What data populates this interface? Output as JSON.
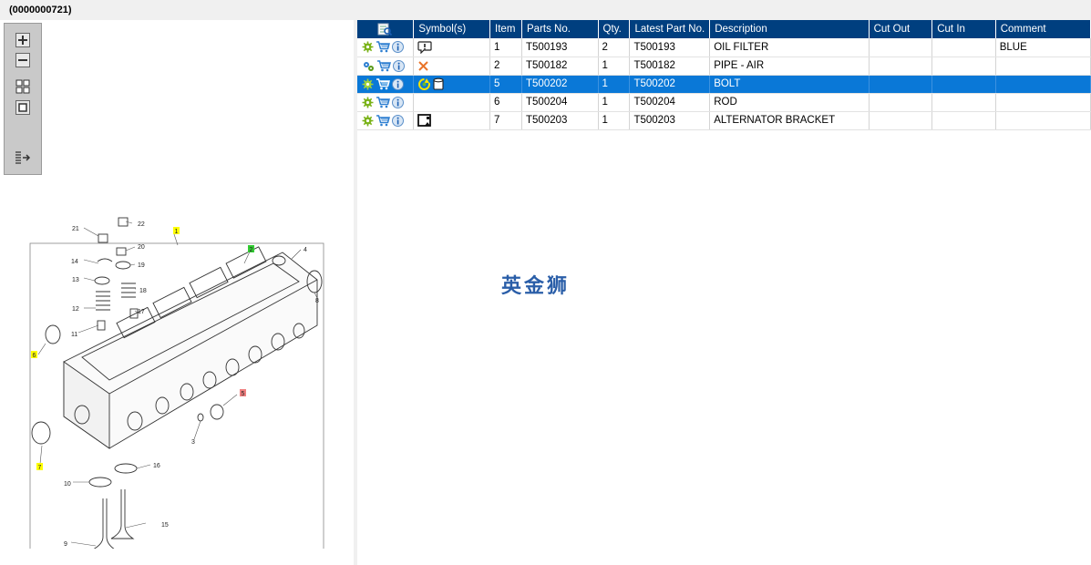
{
  "header": {
    "title": "(0000000721)"
  },
  "toolbar": {
    "buttons": [
      {
        "name": "zoom-in-icon"
      },
      {
        "name": "zoom-out-icon"
      },
      {
        "name": "fit-grid-icon"
      },
      {
        "name": "fit-page-icon"
      },
      {
        "name": "export-list-icon"
      }
    ]
  },
  "diagram": {
    "callouts": [
      "1",
      "2",
      "3",
      "4",
      "5",
      "6",
      "7",
      "8",
      "9",
      "10",
      "11",
      "12",
      "13",
      "14",
      "15",
      "16",
      "17",
      "18",
      "19",
      "20",
      "21",
      "22"
    ],
    "callout_colors": {
      "yellow": "#ffff00",
      "green": "#33cc33",
      "red": "#f08080"
    }
  },
  "table": {
    "headers": [
      "Symbol(s)",
      "Item",
      "Parts No.",
      "Qty.",
      "Latest Part No.",
      "Description",
      "Cut Out",
      "Cut In",
      "Comment"
    ],
    "rows": [
      {
        "item": "1",
        "part_no": "T500193",
        "qty": "2",
        "latest": "T500193",
        "description": "OIL FILTER",
        "cut_out": "",
        "cut_in": "",
        "comment": "BLUE",
        "symbols": [
          "info-bubble-icon"
        ],
        "selected": false
      },
      {
        "item": "2",
        "part_no": "T500182",
        "qty": "1",
        "latest": "T500182",
        "description": "PIPE - AIR",
        "cut_out": "",
        "cut_in": "",
        "comment": "",
        "symbols": [
          "cross-icon"
        ],
        "selected": false
      },
      {
        "item": "5",
        "part_no": "T500202",
        "qty": "1",
        "latest": "T500202",
        "description": "BOLT",
        "cut_out": "",
        "cut_in": "",
        "comment": "",
        "symbols": [
          "recycle-icon",
          "cylinder-icon"
        ],
        "selected": true
      },
      {
        "item": "6",
        "part_no": "T500204",
        "qty": "1",
        "latest": "T500204",
        "description": "ROD",
        "cut_out": "",
        "cut_in": "",
        "comment": "",
        "symbols": [],
        "selected": false
      },
      {
        "item": "7",
        "part_no": "T500203",
        "qty": "1",
        "latest": "T500203",
        "description": "ALTERNATOR BRACKET",
        "cut_out": "",
        "cut_in": "",
        "comment": "",
        "symbols": [
          "image-icon"
        ],
        "selected": false
      }
    ]
  },
  "watermark": {
    "text": "英金狮"
  },
  "colors": {
    "header_bg": "#003f7f",
    "selected_row": "#0a78d7",
    "accent_green": "#7bb31a",
    "cart_blue": "#2e7fd1"
  }
}
